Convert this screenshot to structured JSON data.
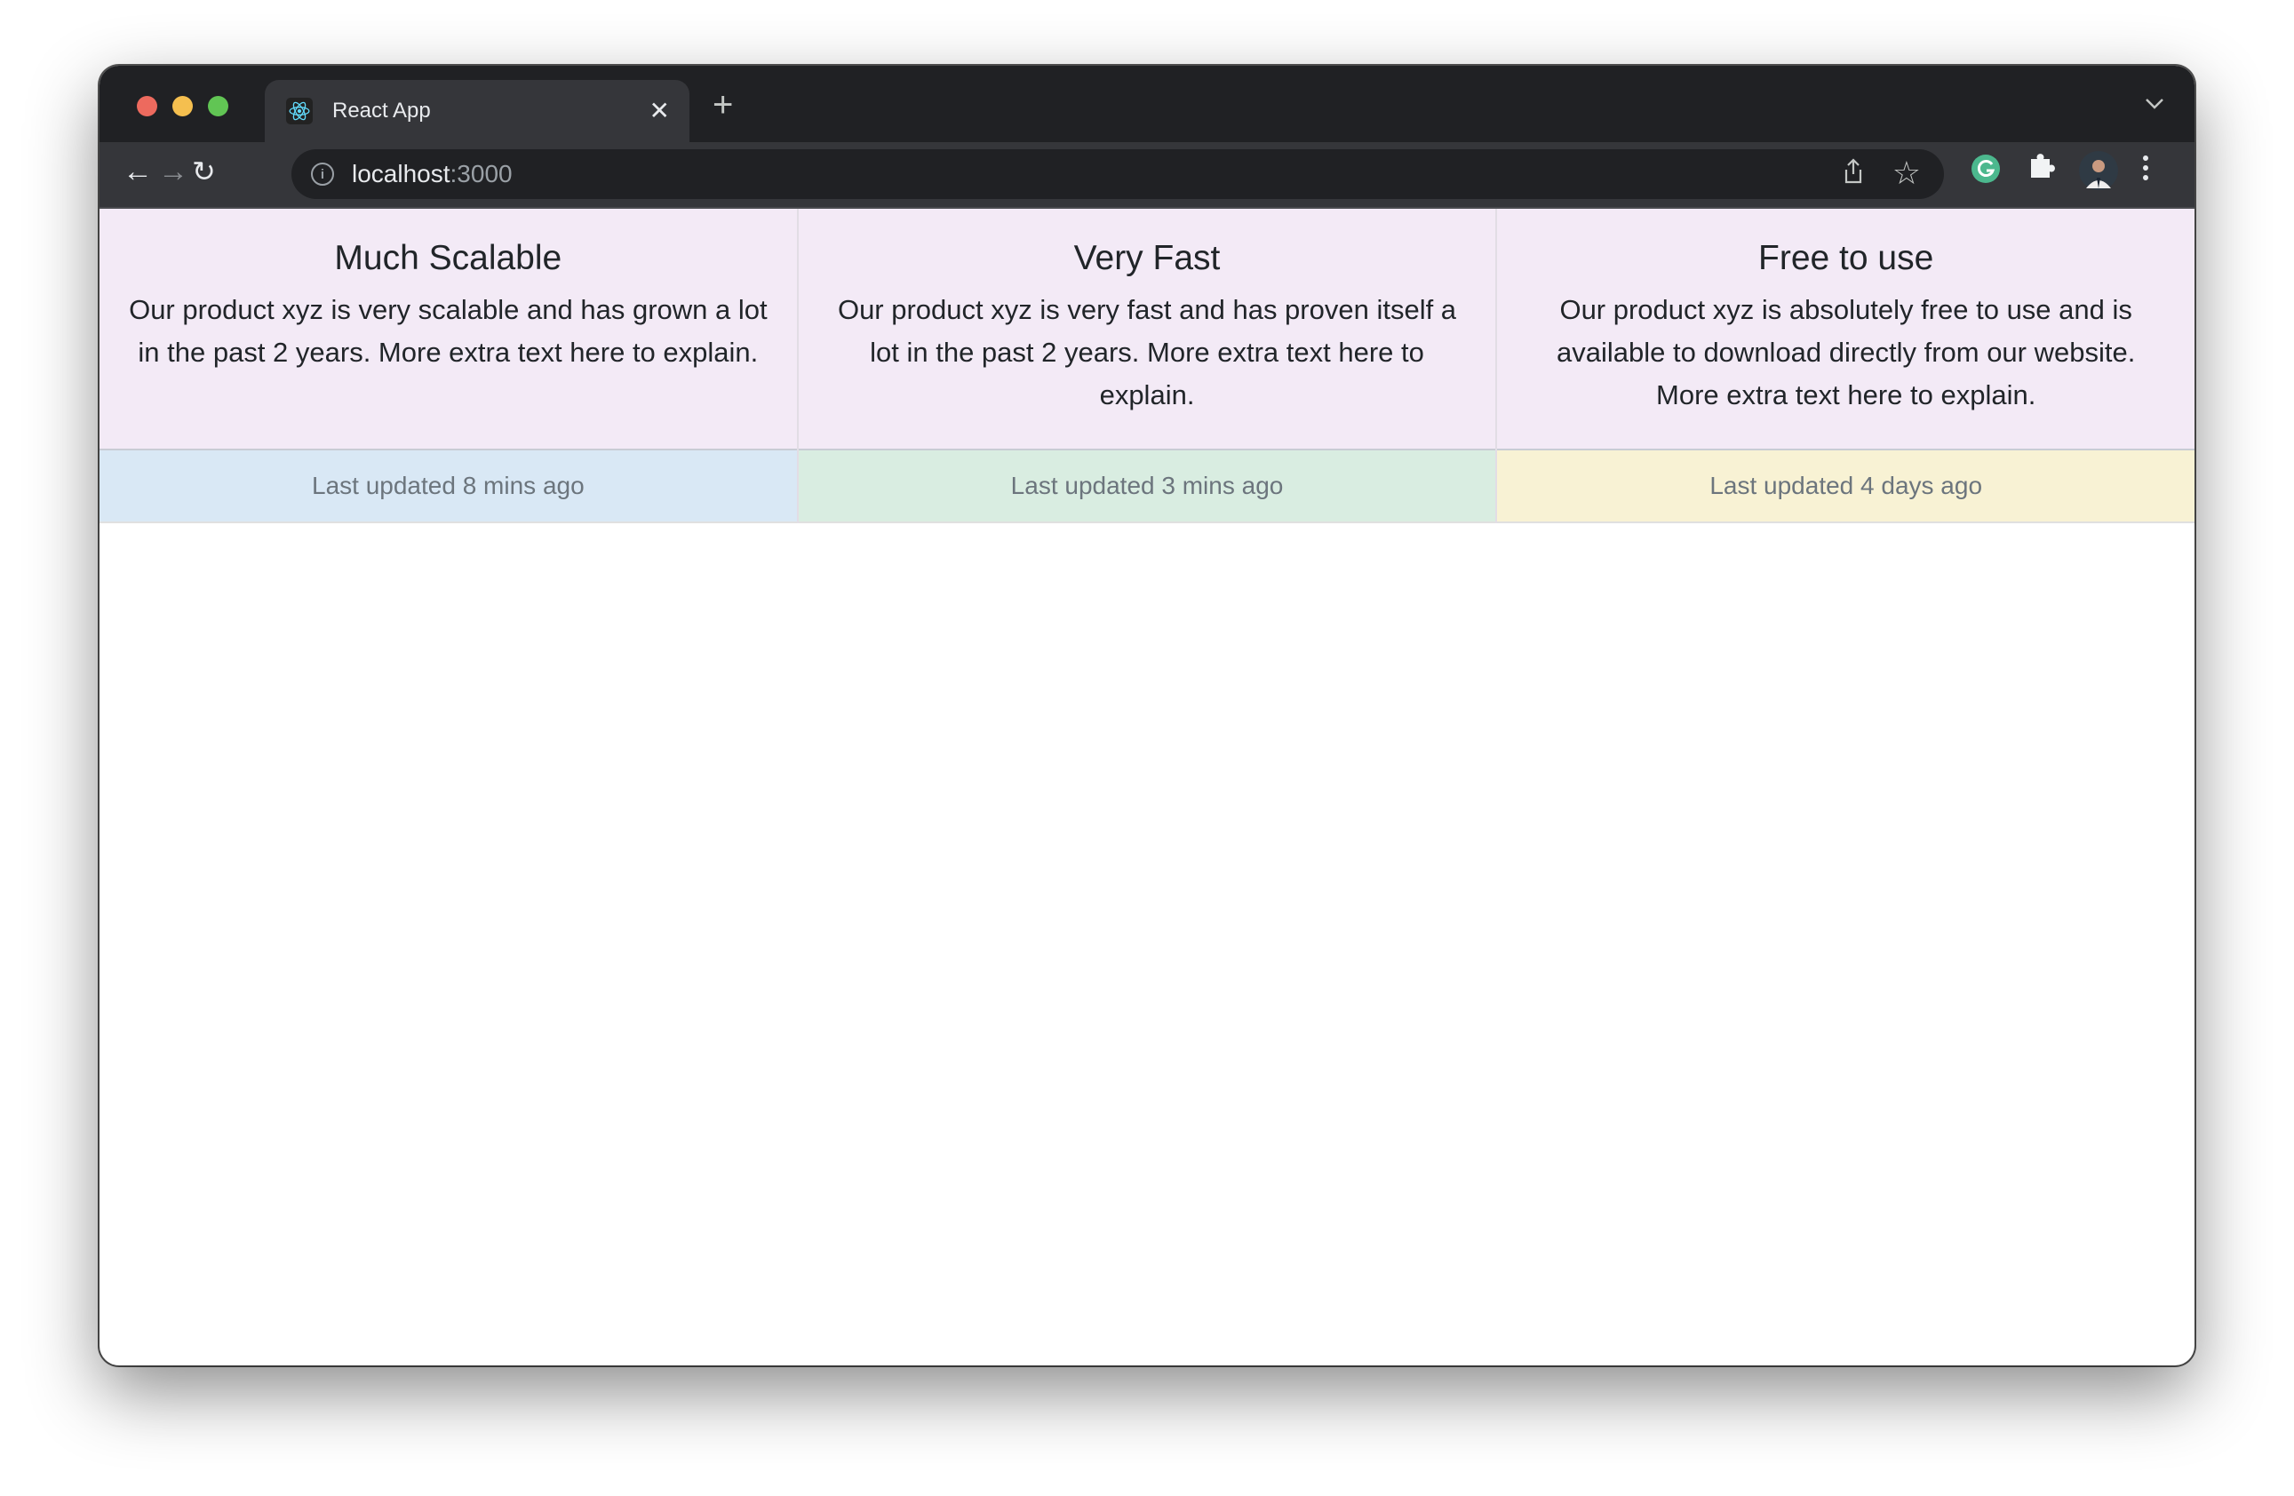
{
  "browser": {
    "tab_title": "React App",
    "url_host": "localhost",
    "url_port": ":3000",
    "traffic_light_colors": [
      "#ed6a5e",
      "#f5bf4f",
      "#61c554"
    ],
    "icons": [
      "react-logo-icon",
      "close-icon",
      "plus-icon",
      "chevron-down-icon",
      "back-icon",
      "forward-icon",
      "reload-icon",
      "info-icon",
      "share-icon",
      "star-icon",
      "grammarly-icon",
      "extensions-icon",
      "avatar",
      "menu-icon"
    ]
  },
  "cards": [
    {
      "title": "Much Scalable",
      "text": "Our product xyz is very scalable and has grown a lot in the past 2 years. More extra text here to explain.",
      "footer": "Last updated 8 mins ago",
      "footer_color": "#d9e8f5"
    },
    {
      "title": "Very Fast",
      "text": "Our product xyz is very fast and has proven itself a lot in the past 2 years. More extra text here to explain.",
      "footer": "Last updated 3 mins ago",
      "footer_color": "#d9ede1"
    },
    {
      "title": "Free to use",
      "text": "Our product xyz is absolutely free to use and is available to download directly from our website. More extra text here to explain.",
      "footer": "Last updated 4 days ago",
      "footer_color": "#f8f2d4"
    }
  ],
  "colors": {
    "card_bg": "#f3eaf6"
  }
}
